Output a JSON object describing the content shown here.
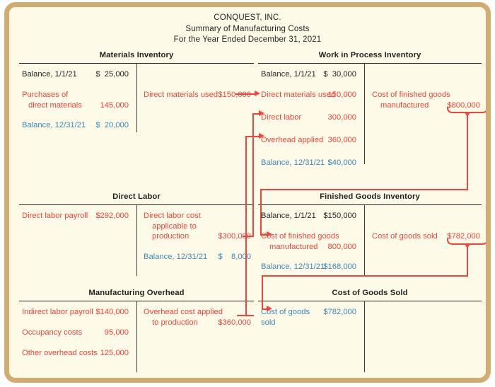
{
  "document": {
    "company": "CONQUEST, INC.",
    "subtitle": "Summary of Manufacturing Costs",
    "period": "For the Year Ended December 31, 2021"
  },
  "colors": {
    "page_background": "#fdfbe8",
    "frame_border": "#d3ac72",
    "flow_red": "#f4433c",
    "balance_blue": "#3a87b5",
    "text_dark": "#231f20"
  },
  "accounts": {
    "materials_inventory": {
      "title": "Materials Inventory",
      "debits": [
        {
          "label": "Balance, 1/1/21",
          "amount": "$  25,000",
          "style": "dark"
        },
        {
          "label": "Purchases of",
          "label2": "direct materials",
          "amount": "145,000",
          "style": "red"
        },
        {
          "label": "Balance, 12/31/21",
          "amount": "$  20,000",
          "style": "blue"
        }
      ],
      "credits": [
        {
          "label": "Direct materials used",
          "amount": "$150,000",
          "style": "red"
        }
      ]
    },
    "work_in_process_inventory": {
      "title": "Work in Process Inventory",
      "debits": [
        {
          "label": "Balance, 1/1/21",
          "amount": "$  30,000",
          "style": "dark"
        },
        {
          "label": "Direct materials used",
          "amount": "150,000",
          "style": "red"
        },
        {
          "label": "Direct labor",
          "amount": "300,000",
          "style": "red"
        },
        {
          "label": "Overhead applied",
          "amount": "360,000",
          "style": "red"
        },
        {
          "label": "Balance, 12/31/21",
          "amount": "$40,000",
          "style": "blue"
        }
      ],
      "credits": [
        {
          "label": "Cost of finished goods",
          "label2": "manufactured",
          "amount": "$800,000",
          "style": "red"
        }
      ]
    },
    "direct_labor": {
      "title": "Direct Labor",
      "debits": [
        {
          "label": "Direct labor payroll",
          "amount": "$292,000",
          "style": "red"
        }
      ],
      "credits": [
        {
          "label": "Direct labor cost",
          "label2": "applicable to",
          "label3": "production",
          "amount": "$300,000",
          "style": "red"
        },
        {
          "label": "Balance, 12/31/21",
          "amount": "$    8,000",
          "style": "blue"
        }
      ]
    },
    "finished_goods_inventory": {
      "title": "Finished Goods Inventory",
      "debits": [
        {
          "label": "Balance, 1/1/21",
          "amount": "$150,000",
          "style": "dark"
        },
        {
          "label": "Cost of finished goods",
          "label2": "manufactured",
          "amount": "800,000",
          "style": "red"
        },
        {
          "label": "Balance, 12/31/21",
          "amount": "$168,000",
          "style": "blue"
        }
      ],
      "credits": [
        {
          "label": "Cost of goods sold",
          "amount": "$782,000",
          "style": "red"
        }
      ]
    },
    "manufacturing_overhead": {
      "title": "Manufacturing Overhead",
      "debits": [
        {
          "label": "Indirect labor payroll",
          "amount": "$140,000",
          "style": "red"
        },
        {
          "label": "Occupancy costs",
          "amount": "95,000",
          "style": "red"
        },
        {
          "label": "Other overhead costs",
          "amount": "125,000",
          "style": "red"
        }
      ],
      "credits": [
        {
          "label": "Overhead cost applied",
          "label2": "to production",
          "amount": "$360,000",
          "style": "red"
        }
      ]
    },
    "cost_of_goods_sold": {
      "title": "Cost of Goods Sold",
      "debits": [
        {
          "label": "Cost of goods",
          "label2": "sold",
          "amount": "$782,000",
          "style": "blue"
        }
      ],
      "credits": []
    }
  },
  "flows": [
    {
      "name": "direct-materials-used",
      "from": "Materials Inventory",
      "to": "Work in Process Inventory",
      "amount": "150,000"
    },
    {
      "name": "direct-labor-applied",
      "from": "Direct Labor",
      "to": "Work in Process Inventory",
      "amount": "300,000"
    },
    {
      "name": "overhead-applied",
      "from": "Manufacturing Overhead",
      "to": "Work in Process Inventory",
      "amount": "360,000"
    },
    {
      "name": "cost-of-finished-goods-manufactured",
      "from": "Work in Process Inventory",
      "to": "Finished Goods Inventory",
      "amount": "800,000"
    },
    {
      "name": "cost-of-goods-sold",
      "from": "Finished Goods Inventory",
      "to": "Cost of Goods Sold",
      "amount": "782,000"
    }
  ]
}
